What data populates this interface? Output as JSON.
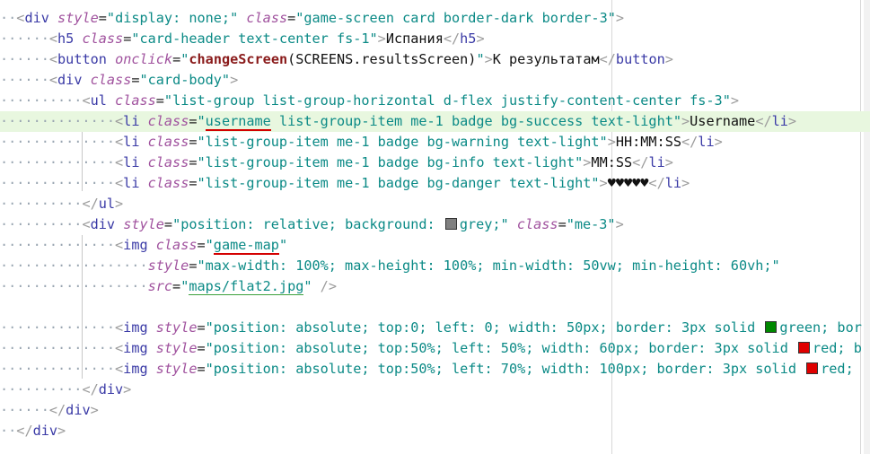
{
  "colors": {
    "green": "#008800",
    "red": "#e00000",
    "grey": "#808080",
    "highlight": "#e8f7df",
    "annotation": "#d40000"
  },
  "lines": [
    {
      "dots": "··",
      "segs": [
        {
          "t": "<",
          "c": "br"
        },
        {
          "t": "div",
          "c": "tg"
        },
        {
          "t": " "
        },
        {
          "t": "style",
          "c": "at"
        },
        {
          "t": "=",
          "c": "eq"
        },
        {
          "t": "\"display: none;\"",
          "c": "st"
        },
        {
          "t": " "
        },
        {
          "t": "class",
          "c": "at"
        },
        {
          "t": "=",
          "c": "eq"
        },
        {
          "t": "\"game-screen card border-dark border-3\"",
          "c": "st"
        },
        {
          "t": ">",
          "c": "br"
        }
      ]
    },
    {
      "dots": "······",
      "segs": [
        {
          "t": "<",
          "c": "br"
        },
        {
          "t": "h5",
          "c": "tg"
        },
        {
          "t": " "
        },
        {
          "t": "class",
          "c": "at"
        },
        {
          "t": "=",
          "c": "eq"
        },
        {
          "t": "\"card-header text-center fs-1\"",
          "c": "st"
        },
        {
          "t": ">",
          "c": "br"
        },
        {
          "t": "Испания",
          "c": "tx"
        },
        {
          "t": "</",
          "c": "br"
        },
        {
          "t": "h5",
          "c": "tg"
        },
        {
          "t": ">",
          "c": "br"
        }
      ]
    },
    {
      "dots": "······",
      "segs": [
        {
          "t": "<",
          "c": "br"
        },
        {
          "t": "button",
          "c": "tg"
        },
        {
          "t": " "
        },
        {
          "t": "onclick",
          "c": "at"
        },
        {
          "t": "=",
          "c": "eq"
        },
        {
          "t": "\"",
          "c": "st"
        },
        {
          "t": "changeScreen",
          "c": "fn"
        },
        {
          "t": "(SCREENS.resultsScreen)",
          "c": "tx"
        },
        {
          "t": "\"",
          "c": "st"
        },
        {
          "t": ">",
          "c": "br"
        },
        {
          "t": "К результатам",
          "c": "tx"
        },
        {
          "t": "</",
          "c": "br"
        },
        {
          "t": "button",
          "c": "tg"
        },
        {
          "t": ">",
          "c": "br"
        }
      ]
    },
    {
      "dots": "······",
      "segs": [
        {
          "t": "<",
          "c": "br"
        },
        {
          "t": "div",
          "c": "tg"
        },
        {
          "t": " "
        },
        {
          "t": "class",
          "c": "at"
        },
        {
          "t": "=",
          "c": "eq"
        },
        {
          "t": "\"card-body\"",
          "c": "st"
        },
        {
          "t": ">",
          "c": "br"
        }
      ]
    },
    {
      "dots": "··········",
      "segs": [
        {
          "t": "<",
          "c": "br"
        },
        {
          "t": "ul",
          "c": "tg"
        },
        {
          "t": " "
        },
        {
          "t": "class",
          "c": "at"
        },
        {
          "t": "=",
          "c": "eq"
        },
        {
          "t": "\"list-group list-group-horizontal d-flex justify-content-center fs-3\"",
          "c": "st"
        },
        {
          "t": ">",
          "c": "br"
        }
      ]
    },
    {
      "dots": "··············",
      "hl": true,
      "segs": [
        {
          "t": "<",
          "c": "br"
        },
        {
          "t": "li",
          "c": "tg"
        },
        {
          "t": " "
        },
        {
          "t": "class",
          "c": "at"
        },
        {
          "t": "=",
          "c": "eq"
        },
        {
          "t": "\"",
          "c": "st"
        },
        {
          "t": "username",
          "c": "st",
          "u": "red"
        },
        {
          "t": " list-group-item me-1 badge bg-success text-light\"",
          "c": "st"
        },
        {
          "t": ">",
          "c": "br"
        },
        {
          "t": "Username",
          "c": "tx"
        },
        {
          "t": "</",
          "c": "br"
        },
        {
          "t": "li",
          "c": "tg"
        },
        {
          "t": ">",
          "c": "br"
        }
      ]
    },
    {
      "dots": "··············",
      "segs": [
        {
          "t": "<",
          "c": "br"
        },
        {
          "t": "li",
          "c": "tg"
        },
        {
          "t": " "
        },
        {
          "t": "class",
          "c": "at"
        },
        {
          "t": "=",
          "c": "eq"
        },
        {
          "t": "\"list-group-item me-1 badge bg-warning text-light\"",
          "c": "st"
        },
        {
          "t": ">",
          "c": "br"
        },
        {
          "t": "HH:MM:SS",
          "c": "tx"
        },
        {
          "t": "</",
          "c": "br"
        },
        {
          "t": "li",
          "c": "tg"
        },
        {
          "t": ">",
          "c": "br"
        }
      ]
    },
    {
      "dots": "··············",
      "segs": [
        {
          "t": "<",
          "c": "br"
        },
        {
          "t": "li",
          "c": "tg"
        },
        {
          "t": " "
        },
        {
          "t": "class",
          "c": "at"
        },
        {
          "t": "=",
          "c": "eq"
        },
        {
          "t": "\"list-group-item me-1 badge bg-info text-light\"",
          "c": "st"
        },
        {
          "t": ">",
          "c": "br"
        },
        {
          "t": "MM:SS",
          "c": "tx"
        },
        {
          "t": "</",
          "c": "br"
        },
        {
          "t": "li",
          "c": "tg"
        },
        {
          "t": ">",
          "c": "br"
        }
      ]
    },
    {
      "dots": "··············",
      "segs": [
        {
          "t": "<",
          "c": "br"
        },
        {
          "t": "li",
          "c": "tg"
        },
        {
          "t": " "
        },
        {
          "t": "class",
          "c": "at"
        },
        {
          "t": "=",
          "c": "eq"
        },
        {
          "t": "\"list-group-item me-1 badge bg-danger text-light\"",
          "c": "st"
        },
        {
          "t": ">",
          "c": "br"
        },
        {
          "t": "♥♥♥♥♥",
          "c": "tx"
        },
        {
          "t": "</",
          "c": "br"
        },
        {
          "t": "li",
          "c": "tg"
        },
        {
          "t": ">",
          "c": "br"
        }
      ]
    },
    {
      "dots": "··········",
      "segs": [
        {
          "t": "</",
          "c": "br"
        },
        {
          "t": "ul",
          "c": "tg"
        },
        {
          "t": ">",
          "c": "br"
        }
      ]
    },
    {
      "dots": "··········",
      "segs": [
        {
          "t": "<",
          "c": "br"
        },
        {
          "t": "div",
          "c": "tg"
        },
        {
          "t": " "
        },
        {
          "t": "style",
          "c": "at"
        },
        {
          "t": "=",
          "c": "eq"
        },
        {
          "t": "\"position: relative; background: ",
          "c": "st"
        },
        {
          "sw": "grey"
        },
        {
          "t": "grey;\"",
          "c": "st"
        },
        {
          "t": " "
        },
        {
          "t": "class",
          "c": "at"
        },
        {
          "t": "=",
          "c": "eq"
        },
        {
          "t": "\"me-3\"",
          "c": "st"
        },
        {
          "t": ">",
          "c": "br"
        }
      ]
    },
    {
      "dots": "··············",
      "segs": [
        {
          "t": "<",
          "c": "br"
        },
        {
          "t": "img",
          "c": "tg"
        },
        {
          "t": " "
        },
        {
          "t": "class",
          "c": "at"
        },
        {
          "t": "=",
          "c": "eq"
        },
        {
          "t": "\"",
          "c": "st"
        },
        {
          "t": "game-map",
          "c": "st",
          "u": "red"
        },
        {
          "t": "\"",
          "c": "st"
        }
      ]
    },
    {
      "dots": "··················",
      "segs": [
        {
          "t": "style",
          "c": "at"
        },
        {
          "t": "=",
          "c": "eq"
        },
        {
          "t": "\"max-width: 100%; max-height: 100%; min-width: 50vw; min-height: 60vh;\"",
          "c": "st"
        }
      ]
    },
    {
      "dots": "··················",
      "segs": [
        {
          "t": "src",
          "c": "at"
        },
        {
          "t": "=",
          "c": "eq"
        },
        {
          "t": "\"",
          "c": "st"
        },
        {
          "t": "maps/flat2.jpg",
          "c": "st",
          "u": "green"
        },
        {
          "t": "\"",
          "c": "st"
        },
        {
          "t": " "
        },
        {
          "t": "/>",
          "c": "br"
        }
      ]
    },
    {
      "dots": "",
      "segs": []
    },
    {
      "dots": "··············",
      "segs": [
        {
          "t": "<",
          "c": "br"
        },
        {
          "t": "img",
          "c": "tg"
        },
        {
          "t": " "
        },
        {
          "t": "style",
          "c": "at"
        },
        {
          "t": "=",
          "c": "eq"
        },
        {
          "t": "\"position: absolute; top:0; left: 0; width: 50px; border: 3px solid ",
          "c": "st"
        },
        {
          "sw": "green"
        },
        {
          "t": "green; bor",
          "c": "st"
        }
      ]
    },
    {
      "dots": "··············",
      "segs": [
        {
          "t": "<",
          "c": "br"
        },
        {
          "t": "img",
          "c": "tg"
        },
        {
          "t": " "
        },
        {
          "t": "style",
          "c": "at"
        },
        {
          "t": "=",
          "c": "eq"
        },
        {
          "t": "\"position: absolute; top:50%; left: 50%; width: 60px; border: 3px solid ",
          "c": "st"
        },
        {
          "sw": "red"
        },
        {
          "t": "red; b",
          "c": "st"
        }
      ]
    },
    {
      "dots": "··············",
      "segs": [
        {
          "t": "<",
          "c": "br"
        },
        {
          "t": "img",
          "c": "tg"
        },
        {
          "t": " "
        },
        {
          "t": "style",
          "c": "at"
        },
        {
          "t": "=",
          "c": "eq"
        },
        {
          "t": "\"position: absolute; top:50%; left: 70%; width: 100px; border: 3px solid ",
          "c": "st"
        },
        {
          "sw": "red"
        },
        {
          "t": "red;",
          "c": "st"
        }
      ]
    },
    {
      "dots": "··········",
      "segs": [
        {
          "t": "</",
          "c": "br"
        },
        {
          "t": "div",
          "c": "tg"
        },
        {
          "t": ">",
          "c": "br"
        }
      ]
    },
    {
      "dots": "······",
      "segs": [
        {
          "t": "</",
          "c": "br"
        },
        {
          "t": "div",
          "c": "tg"
        },
        {
          "t": ">",
          "c": "br"
        }
      ]
    },
    {
      "dots": "··",
      "segs": [
        {
          "t": "</",
          "c": "br"
        },
        {
          "t": "div",
          "c": "tg"
        },
        {
          "t": ">",
          "c": "br"
        }
      ]
    }
  ]
}
